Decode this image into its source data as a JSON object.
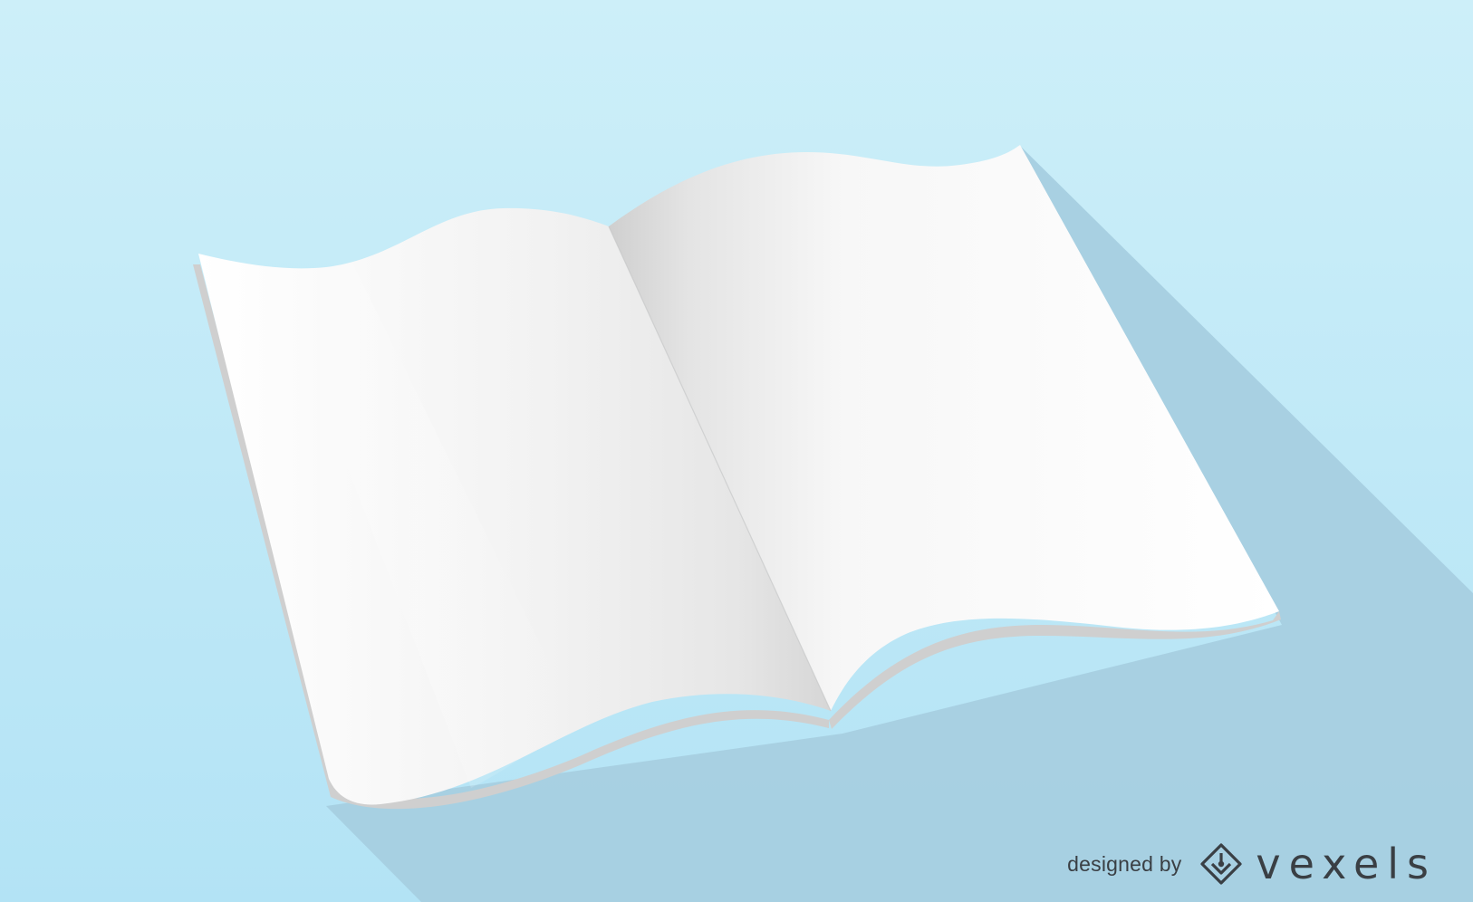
{
  "scene": {
    "subject": "open-blank-book",
    "background_top": "#cdeff9",
    "background_bottom": "#b3e3f5",
    "long_shadow": "#a6cfe0",
    "page_color": "#ffffff",
    "page_edge_color": "#d2d2d2"
  },
  "credit": {
    "prefix": "designed by",
    "brand": "vexels",
    "icon": "vexels-diamond-logo-icon",
    "text_color": "#3a3f44"
  }
}
